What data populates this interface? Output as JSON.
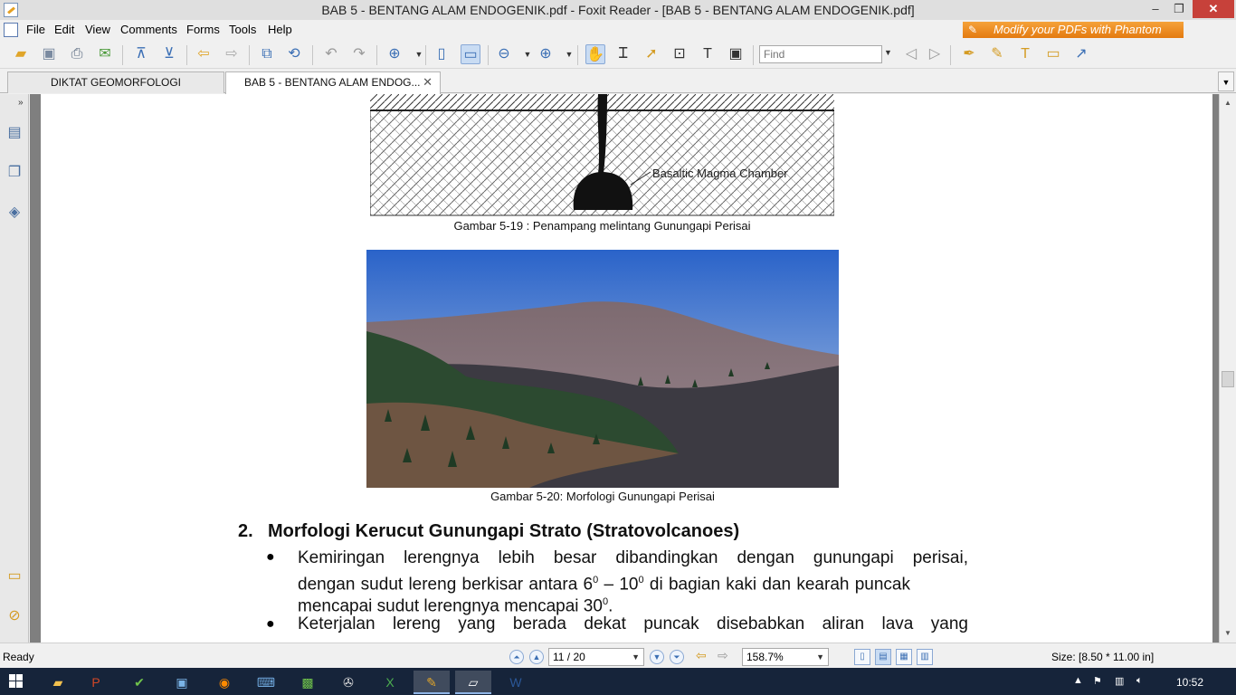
{
  "window": {
    "title": "BAB 5 - BENTANG ALAM ENDOGENIK.pdf - Foxit Reader - [BAB 5 - BENTANG ALAM ENDOGENIK.pdf]",
    "minimize": "–",
    "maximize": "❐",
    "close": "✕"
  },
  "menu": [
    "File",
    "Edit",
    "View",
    "Comments",
    "Forms",
    "Tools",
    "Help"
  ],
  "promo": "Modify your PDFs with Phantom",
  "toolbar": {
    "find_placeholder": "Find"
  },
  "tabs": [
    {
      "label": "DIKTAT GEOMORFOLOGI",
      "active": false
    },
    {
      "label": "BAB 5 - BENTANG ALAM ENDOG...",
      "active": true,
      "close": "✕"
    }
  ],
  "document": {
    "figure1_label": "Basaltic Magma Chamber",
    "figure1_caption": "Gambar 5-19 : Penampang melintang Gunungapi Perisai",
    "figure2_caption": "Gambar 5-20: Morfologi Gunungapi Perisai",
    "section_number": "2.",
    "section_title": "Morfologi Kerucut Gunungapi Strato (Stratovolcanoes)",
    "bullet1": {
      "line1": "Kemiringan lerengnya lebih besar dibandingkan dengan gunungapi perisai,",
      "line2_pre": "dengan sudut lereng berkisar antara  6",
      "sup": "0",
      "line2_mid": " – 10",
      "line2_post": " di bagian kaki dan kearah puncak",
      "line3_pre": "mencapai sudut lerengnya mencapai 30",
      "line3_post": "."
    },
    "bullet2": {
      "line1": "Keterjalan lereng yang berada dekat puncak disebabkan aliran lava yang"
    }
  },
  "status": {
    "ready": "Ready",
    "page": "11 / 20",
    "zoom": "158.7%",
    "size": "Size: [8.50 * 11.00 in]"
  },
  "taskbar": {
    "clock": "10:52"
  }
}
